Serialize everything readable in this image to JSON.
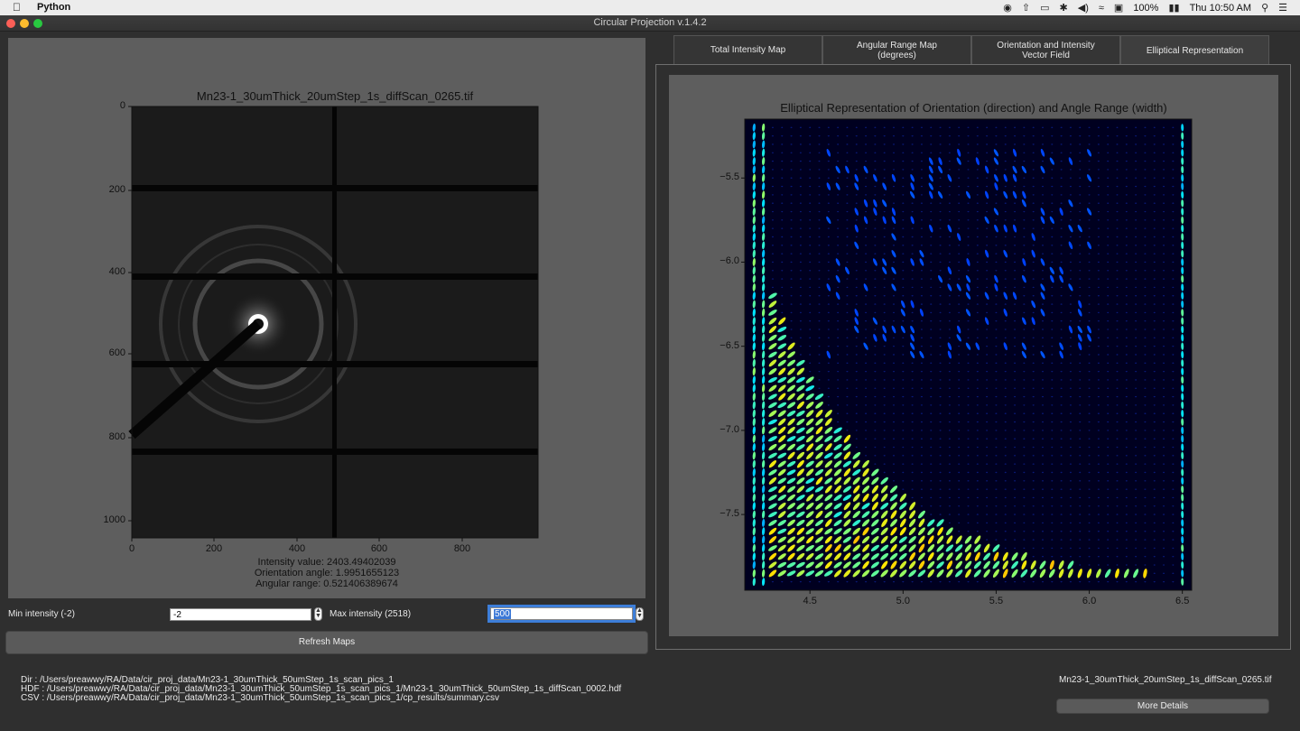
{
  "menubar": {
    "app_name": "Python",
    "battery": "100%",
    "clock": "Thu 10:50 AM"
  },
  "window": {
    "title": "Circular Projection v.1.4.2"
  },
  "left_plot": {
    "title": "Mn23-1_30umThick_20umStep_1s_diffScan_0265.tif",
    "y_ticks": [
      "0",
      "200",
      "400",
      "600",
      "800",
      "1000"
    ],
    "x_ticks": [
      "0",
      "200",
      "400",
      "600",
      "800"
    ],
    "info": {
      "intensity": "Intensity value: 2403.49402039",
      "orientation": "Orientation angle: 1.9951655123",
      "angular": "Angular range: 0.521406389674"
    }
  },
  "controls": {
    "min_label": "Min intensity (-2)",
    "min_value": "-2",
    "max_label": "Max intensity (2518)",
    "max_value": "500",
    "refresh_label": "Refresh Maps"
  },
  "tabs": [
    {
      "label": "Total Intensity Map",
      "active": false
    },
    {
      "label": "Angular Range Map\n(degrees)",
      "active": false
    },
    {
      "label": "Orientation and Intensity\nVector Field",
      "active": false
    },
    {
      "label": "Elliptical Representation",
      "active": true
    }
  ],
  "right_plot": {
    "title": "Elliptical Representation of Orientation (direction) and Angle Range (width)"
  },
  "chart_data": {
    "type": "scatter",
    "title": "Elliptical Representation of Orientation (direction) and Angle Range (width)",
    "xlabel": "",
    "ylabel": "",
    "xlim": [
      4.15,
      6.55
    ],
    "ylim": [
      -7.95,
      -5.15
    ],
    "x_ticks": [
      "4.5",
      "5.0",
      "5.5",
      "6.0",
      "6.5"
    ],
    "y_ticks": [
      "−5.5",
      "−6.0",
      "−6.5",
      "−7.0",
      "−7.5"
    ],
    "x_tick_values": [
      4.5,
      5.0,
      5.5,
      6.0,
      6.5
    ],
    "y_tick_values": [
      -5.5,
      -6.0,
      -6.5,
      -7.0,
      -7.5
    ],
    "grid": false,
    "colormap": [
      "#00007f",
      "#0000ff",
      "#0080ff",
      "#00e5ff",
      "#7dff7a",
      "#ffe600",
      "#ff4a00",
      "#cc0000"
    ],
    "background": "#000020"
  },
  "footer": {
    "dir": "Dir : /Users/preawwy/RA/Data/cir_proj_data/Mn23-1_30umThick_50umStep_1s_scan_pics_1",
    "hdf": "HDF : /Users/preawwy/RA/Data/cir_proj_data/Mn23-1_30umThick_50umStep_1s_scan_pics_1/Mn23-1_30umThick_50umStep_1s_diffScan_0002.hdf",
    "csv": "CSV : /Users/preawwy/RA/Data/cir_proj_data/Mn23-1_30umThick_50umStep_1s_scan_pics_1/cp_results/summary.csv",
    "filename": "Mn23-1_30umThick_20umStep_1s_diffScan_0265.tif",
    "more_details_label": "More Details"
  }
}
